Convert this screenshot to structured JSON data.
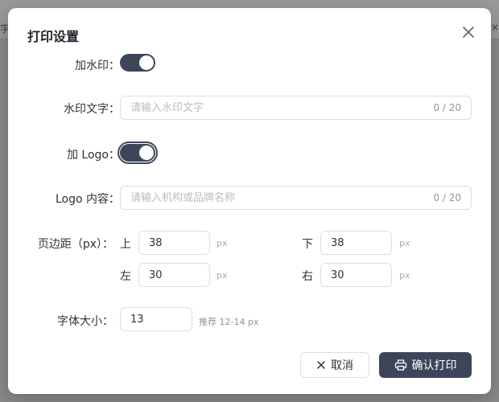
{
  "background": {
    "left_fragment": "字",
    "right_fragment": "×"
  },
  "dialog": {
    "title": "打印设置",
    "close_icon": "close-icon"
  },
  "watermark": {
    "label": "加水印：",
    "enabled": true
  },
  "watermark_text": {
    "label": "水印文字：",
    "placeholder": "请输入水印文字",
    "value": "",
    "counter": "0 / 20"
  },
  "logo": {
    "label": "加 Logo：",
    "enabled": true
  },
  "logo_content": {
    "label": "Logo 内容：",
    "placeholder": "请输入机构或品牌名称",
    "value": "",
    "counter": "0 / 20"
  },
  "margins": {
    "label": "页边距（px）：",
    "unit": "px",
    "top": {
      "label": "上",
      "value": "38"
    },
    "bottom": {
      "label": "下",
      "value": "38"
    },
    "left": {
      "label": "左",
      "value": "30"
    },
    "right": {
      "label": "右",
      "value": "30"
    }
  },
  "font_size": {
    "label": "字体大小：",
    "value": "13",
    "hint": "推荐 12-14 px"
  },
  "footer": {
    "cancel_label": "取消",
    "confirm_label": "确认打印",
    "cancel_icon": "close-icon",
    "confirm_icon": "printer-icon"
  },
  "colors": {
    "primary": "#3d4659",
    "border": "#dcdfe6",
    "placeholder": "#b8bcc4"
  }
}
